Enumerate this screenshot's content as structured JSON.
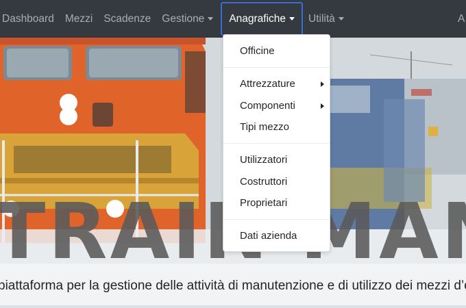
{
  "navbar": {
    "items": [
      {
        "label": "Dashboard"
      },
      {
        "label": "Mezzi"
      },
      {
        "label": "Scadenze"
      },
      {
        "label": "Gestione"
      },
      {
        "label": "Anagrafiche"
      },
      {
        "label": "Utilità"
      },
      {
        "label": "A"
      }
    ]
  },
  "hero": {
    "title": "TRAIN MANAGER",
    "subtitle": "piattaforma per la gestione delle attività di manutenzione e di utilizzo dei mezzi d’opera"
  },
  "dropdown": {
    "items": [
      {
        "label": "Officine"
      },
      {
        "label": "Attrezzature"
      },
      {
        "label": "Componenti"
      },
      {
        "label": "Tipi mezzo"
      },
      {
        "label": "Utilizzatori"
      },
      {
        "label": "Costruttori"
      },
      {
        "label": "Proprietari"
      },
      {
        "label": "Dati azienda"
      }
    ]
  },
  "colors": {
    "navbar_bg": "#343a40",
    "active_border": "#3a6fd1",
    "locomotive_orange": "#e0632a",
    "locomotive_yellow": "#d8a43a",
    "locomotive_blue": "#4a6a9a"
  }
}
